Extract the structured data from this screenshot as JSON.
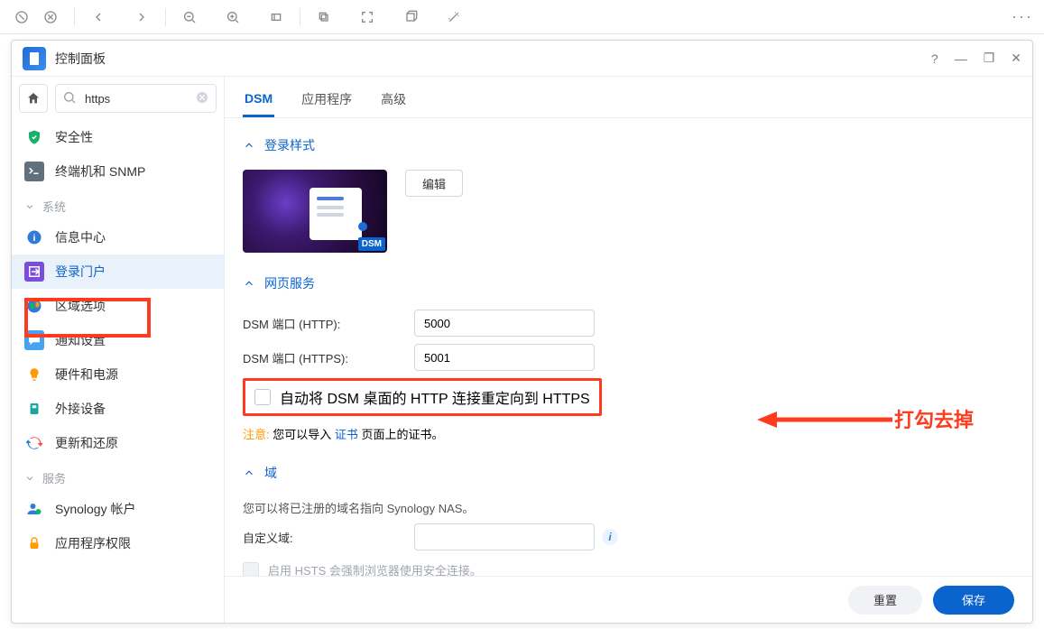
{
  "toolbar_dots": "···",
  "window": {
    "title": "控制面板",
    "help": "?",
    "min": "—",
    "max": "❐",
    "close": "✕"
  },
  "search": {
    "value": "https"
  },
  "sidebar": {
    "items": {
      "security": "安全性",
      "terminal": "终端机和 SNMP"
    },
    "group_system": "系统",
    "system": {
      "info": "信息中心",
      "login": "登录门户",
      "region": "区域选项",
      "notify": "通知设置",
      "hardware": "硬件和电源",
      "external": "外接设备",
      "update": "更新和还原"
    },
    "group_service": "服务",
    "service": {
      "syno": "Synology 帐户",
      "perm": "应用程序权限"
    }
  },
  "tabs": {
    "dsm": "DSM",
    "app": "应用程序",
    "adv": "高级"
  },
  "section": {
    "login_style": "登录样式",
    "web": "网页服务",
    "domain": "域"
  },
  "preview_badge": "DSM",
  "buttons": {
    "edit": "编辑",
    "reset": "重置",
    "save": "保存"
  },
  "web": {
    "http_label": "DSM 端口 (HTTP):",
    "http_value": "5000",
    "https_label": "DSM 端口 (HTTPS):",
    "https_value": "5001",
    "redirect_label": "自动将 DSM 桌面的 HTTP 连接重定向到 HTTPS",
    "note_prefix": "注意:",
    "note_text1": " 您可以导入 ",
    "note_link": "证书",
    "note_text2": " 页面上的证书。"
  },
  "domain": {
    "desc": "您可以将已注册的域名指向 Synology NAS。",
    "custom_label": "自定义域:",
    "custom_value": "",
    "hsts_label": "启用 HSTS 会强制浏览器使用安全连接。"
  },
  "annotation": {
    "text": "打勾去掉"
  }
}
